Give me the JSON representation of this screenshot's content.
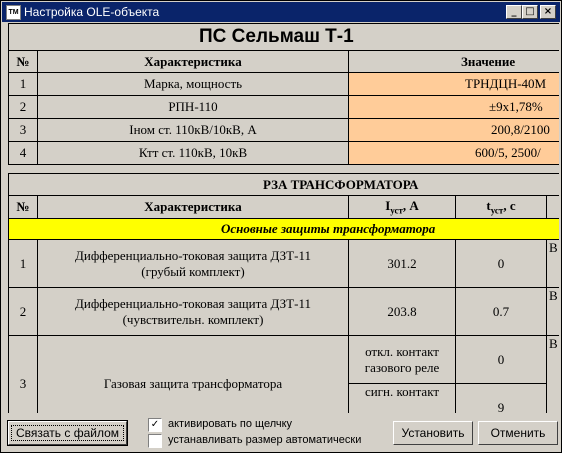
{
  "window": {
    "icon_text": "TM",
    "title": "Настройка OLE-объекта",
    "minimize": "_",
    "maximize": "□",
    "close": "×"
  },
  "sheet": {
    "title": "ПС Сельмаш Т-1",
    "top_headers": {
      "num": "№",
      "char": "Характеристика",
      "value": "Значение"
    },
    "top_rows": [
      {
        "num": "1",
        "char": "Марка, мощность",
        "value": "ТРНДЦН-40М"
      },
      {
        "num": "2",
        "char": "РПН-110",
        "value": "±9х1,78%"
      },
      {
        "num": "3",
        "char": "Iном ст. 110кВ/10кВ, А",
        "value": "200,8/2100"
      },
      {
        "num": "4",
        "char": "Ктт ст. 110кВ, 10кВ",
        "value": "600/5, 2500/"
      }
    ],
    "section_title": "РЗА ТРАНСФОРМАТОРА",
    "rza_headers": {
      "num": "№",
      "char": "Характеристика",
      "iust_main": "I",
      "iust_sub": "уст",
      "iust_unit": ", А",
      "tust_main": "t",
      "tust_sub": "уст",
      "tust_unit": ", с"
    },
    "subsection": "Основные защиты трансформатора",
    "rza_rows": [
      {
        "num": "1",
        "char_l1": "Дифференциально-токовая защита ДЗТ-11",
        "char_l2": "(грубый комплект)",
        "iust": "301.2",
        "tust": "0",
        "extra": "В"
      },
      {
        "num": "2",
        "char_l1": "Дифференциально-токовая защита ДЗТ-11",
        "char_l2": "(чувствительн. комплект)",
        "iust": "203.8",
        "tust": "0.7",
        "extra": "В"
      },
      {
        "num": "3",
        "char": "Газовая защита трансформатора",
        "sub1_l1": "откл. контакт",
        "sub1_l2": "газового реле",
        "sub1_t": "0",
        "sub2_l1": "сигн. контакт",
        "sub2_t": "9",
        "extra": "В"
      }
    ]
  },
  "footer": {
    "link_button": "Связать с файлом",
    "activate_label": "активировать по щелчку",
    "activate_checked": "✓",
    "autosize_label": "устанавливать размер автоматически",
    "install_button": "Установить",
    "cancel_button": "Отменить"
  }
}
